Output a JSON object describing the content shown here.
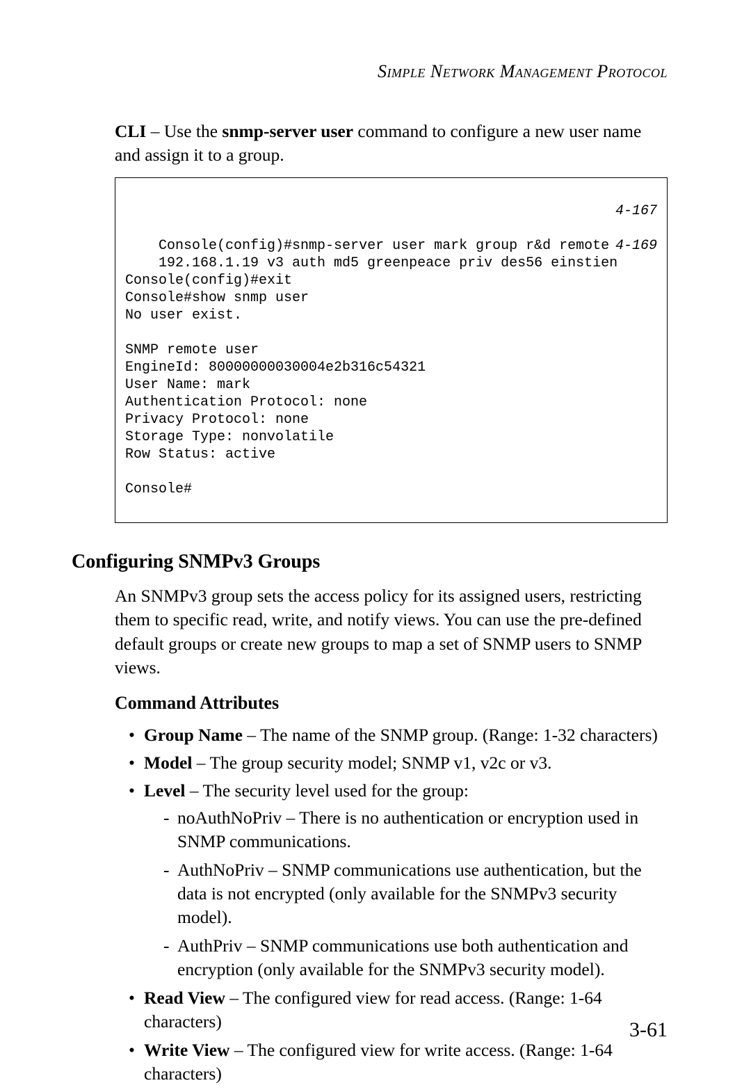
{
  "header": {
    "running": "Simple Network Management Protocol"
  },
  "intro": {
    "cli_label": "CLI",
    "cli_dash": " – Use the ",
    "cli_cmd": "snmp-server user",
    "cli_tail": " command to configure a new user name and assign it to a group."
  },
  "cli": {
    "text": "Console(config)#snmp-server user mark group r&d remote\n    192.168.1.19 v3 auth md5 greenpeace priv des56 einstien\nConsole(config)#exit\nConsole#show snmp user\nNo user exist.\n\nSNMP remote user\nEngineId: 80000000030004e2b316c54321\nUser Name: mark\nAuthentication Protocol: none\nPrivacy Protocol: none\nStorage Type: nonvolatile\nRow Status: active\n\nConsole#",
    "ref1": "4-167",
    "ref2": "4-169"
  },
  "section": {
    "title": "Configuring SNMPv3 Groups",
    "body": "An SNMPv3 group sets the access policy for its assigned users, restricting them to specific read, write, and notify views. You can use the pre-defined default groups or create new groups to map a set of SNMP users to SNMP views."
  },
  "attrs": {
    "title": "Command Attributes",
    "items": {
      "group_name_b": "Group Name",
      "group_name_t": " – The name of the SNMP group. (Range: 1-32 characters)",
      "model_b": "Model",
      "model_t": " – The group security model; SNMP v1, v2c or v3.",
      "level_b": "Level",
      "level_t": " – The security level used for the group:",
      "level_sub": {
        "a": "noAuthNoPriv – There is no authentication or encryption used in SNMP communications.",
        "b": "AuthNoPriv – SNMP communications use authentication, but the data is not encrypted (only available for the SNMPv3 security model).",
        "c": "AuthPriv – SNMP communications use both authentication and encryption (only available for the SNMPv3 security model)."
      },
      "read_b": "Read View",
      "read_t": " – The configured view for read access. (Range: 1-64 characters)",
      "write_b": "Write View",
      "write_t": " – The configured view for write access. (Range: 1-64 characters)"
    }
  },
  "page_number": "3-61"
}
